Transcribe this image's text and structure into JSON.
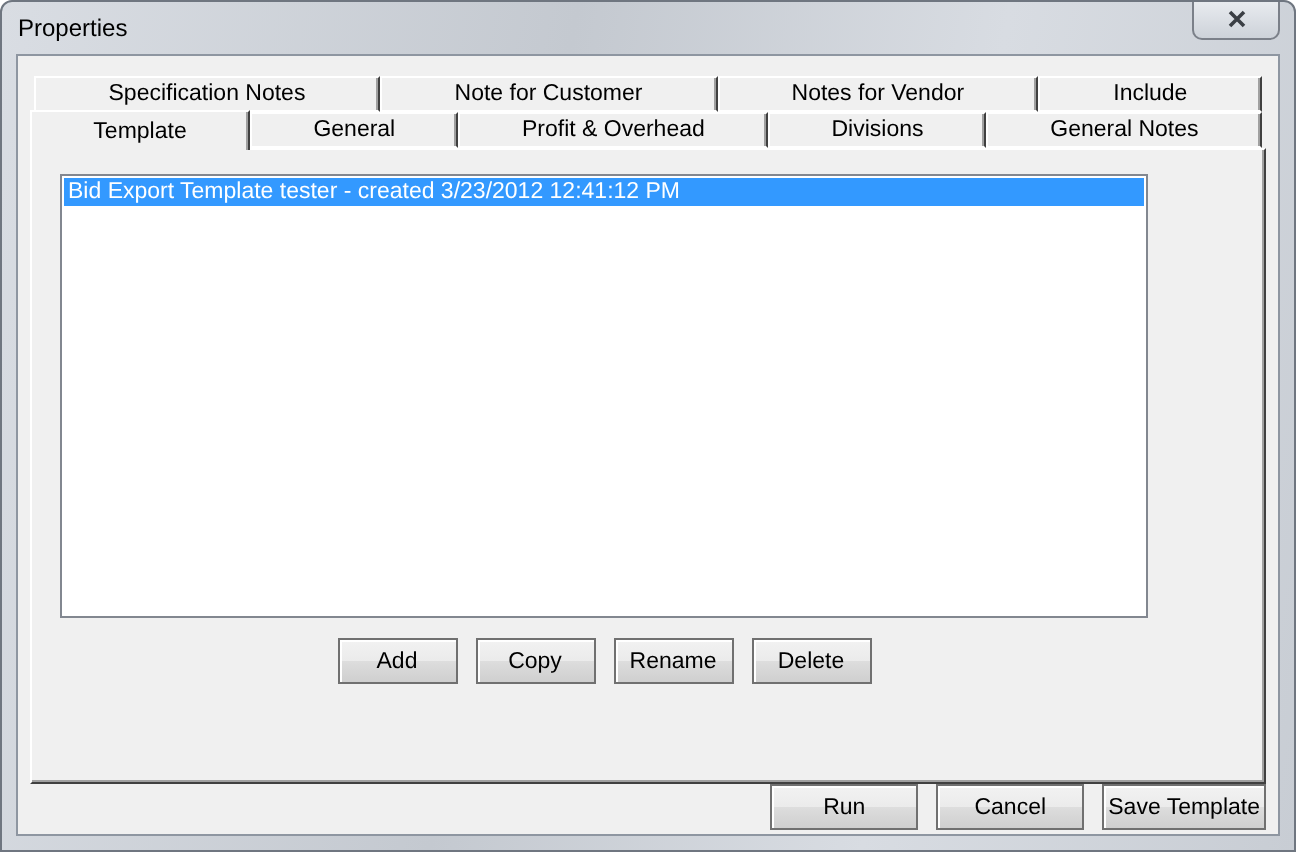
{
  "window": {
    "title": "Properties"
  },
  "tab_rows": [
    [
      {
        "label": "Specification Notes",
        "selected": false
      },
      {
        "label": "Note for Customer",
        "selected": false
      },
      {
        "label": "Notes for Vendor",
        "selected": false
      },
      {
        "label": "Include",
        "selected": false
      }
    ],
    [
      {
        "label": "Template",
        "selected": true
      },
      {
        "label": "General",
        "selected": false
      },
      {
        "label": "Profit & Overhead",
        "selected": false
      },
      {
        "label": "Divisions",
        "selected": false
      },
      {
        "label": "General Notes",
        "selected": false
      }
    ]
  ],
  "templates": [
    {
      "label": "Bid Export Template tester - created 3/23/2012 12:41:12 PM",
      "selected": true
    }
  ],
  "list_buttons": [
    "Add",
    "Copy",
    "Rename",
    "Delete"
  ],
  "dialog_buttons": [
    "Run",
    "Cancel",
    "Save Template"
  ]
}
